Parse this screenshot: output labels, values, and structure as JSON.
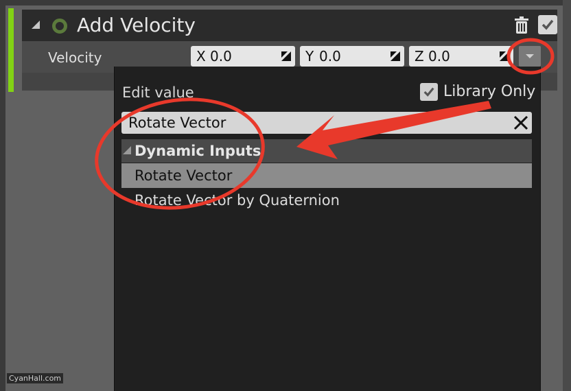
{
  "module": {
    "title": "Add Velocity",
    "collapse_icon": "collapse-triangle-icon",
    "status_icon": "ring-icon",
    "delete_icon": "trash-icon",
    "enabled": true,
    "accent_color": "#82d214"
  },
  "velocity": {
    "label": "Velocity",
    "fields": [
      {
        "axis": "X",
        "value": "0.0"
      },
      {
        "axis": "Y",
        "value": "0.0"
      },
      {
        "axis": "Z",
        "value": "0.0"
      }
    ],
    "dropdown_icon": "chevron-down-icon"
  },
  "popup": {
    "header": "Edit value",
    "library_only": {
      "label": "Library Only",
      "checked": true
    },
    "search": {
      "value": "Rotate Vector",
      "clear_icon": "close-icon"
    },
    "category": {
      "label": "Dynamic Inputs"
    },
    "items": [
      {
        "label": "Rotate Vector",
        "selected": true
      },
      {
        "label": "Rotate Vector by Quaternion",
        "selected": false
      }
    ]
  },
  "annotations": {
    "color": "#e8392b"
  },
  "watermark": "CyanHall.com"
}
